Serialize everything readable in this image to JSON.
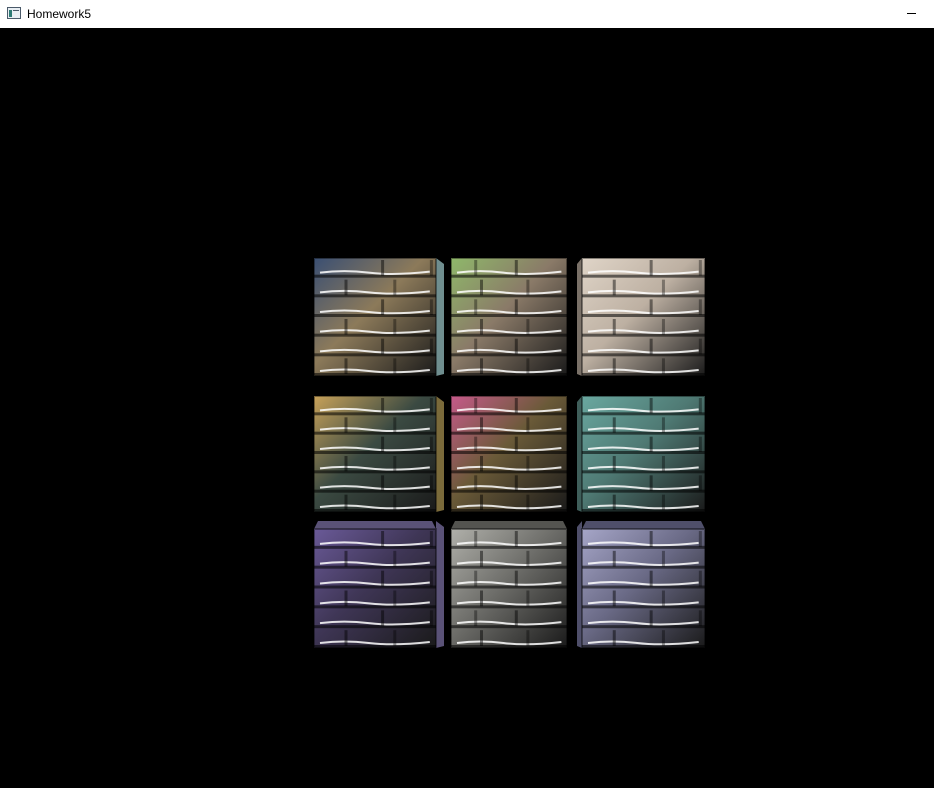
{
  "window": {
    "title": "Homework5",
    "icon": "app-window-icon",
    "controls": [
      "minimize"
    ]
  },
  "scene": {
    "background_color": "#000000",
    "object": "brick-textured-cube",
    "cubes": [
      {
        "name": "cube-r1-c1",
        "tint": "#8c7a5a",
        "accent": "#3a4f73",
        "side": "#6f8e8f"
      },
      {
        "name": "cube-r1-c2",
        "tint": "#8a7a68",
        "accent": "#8fb86a",
        "side": "#6f6a62"
      },
      {
        "name": "cube-r1-c3",
        "tint": "#bdb0a2",
        "accent": "#e0d5c8",
        "side": "#7a7168"
      },
      {
        "name": "cube-r2-c1",
        "tint": "#3b4a42",
        "accent": "#c8a25a",
        "side": "#7a6a3a"
      },
      {
        "name": "cube-r2-c2",
        "tint": "#6a5a38",
        "accent": "#c65a8a",
        "side": "#4f7a5a"
      },
      {
        "name": "cube-r2-c3",
        "tint": "#4f7a74",
        "accent": "#6aa8a0",
        "side": "#3f5e5a"
      },
      {
        "name": "cube-r3-c1",
        "tint": "#3f3656",
        "accent": "#6a5a98",
        "side": "#5a5277"
      },
      {
        "name": "cube-r3-c2",
        "tint": "#6e6e6a",
        "accent": "#b0b0aa",
        "side": "#545450"
      },
      {
        "name": "cube-r3-c3",
        "tint": "#6a6a86",
        "accent": "#a6a6c8",
        "side": "#4f4f6a"
      }
    ]
  }
}
